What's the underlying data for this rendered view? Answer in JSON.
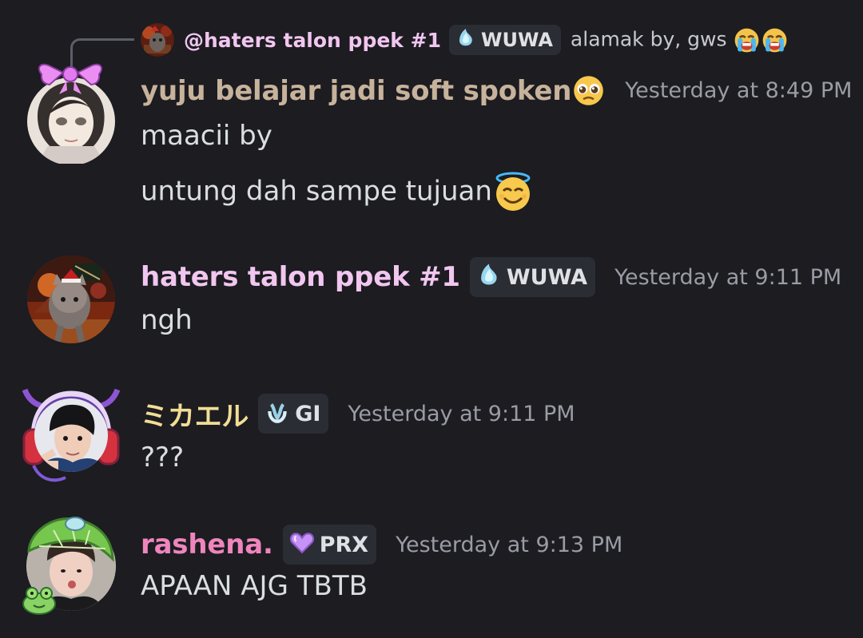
{
  "reply": {
    "name": "@haters talon ppek #1",
    "tag": "WUWA",
    "text": "alamak by, gws",
    "emojis": [
      "loudly-crying-face",
      "loudly-crying-face"
    ]
  },
  "messages": [
    {
      "username": "yuju belajar jadi soft spoken",
      "username_color": "#c7b29b",
      "username_emoji": "pleading-face",
      "timestamp": "Yesterday at 8:49 PM",
      "lines": [
        "maacii by",
        "untung dah sampe tujuan"
      ],
      "line_emojis": [
        "",
        "smiling-face-with-halo"
      ]
    },
    {
      "username": "haters talon ppek #1",
      "username_color": "#f1c6ef",
      "tag": "WUWA",
      "timestamp": "Yesterday at 9:11 PM",
      "lines": [
        "ngh"
      ]
    },
    {
      "username": "ミカエル",
      "username_color": "#f1dd95",
      "tag": "GI",
      "timestamp": "Yesterday at 9:11 PM",
      "lines": [
        "???"
      ]
    },
    {
      "username": "rashena.",
      "username_color": "#ee85bd",
      "tag": "PRX",
      "timestamp": "Yesterday at 9:13 PM",
      "lines": [
        "APAAN AJG TBTB"
      ]
    }
  ],
  "colors": {
    "background": "#1c1c21",
    "tag_background": "#2b2d35",
    "timestamp": "#9a9ca4",
    "text": "#dbdee1"
  }
}
